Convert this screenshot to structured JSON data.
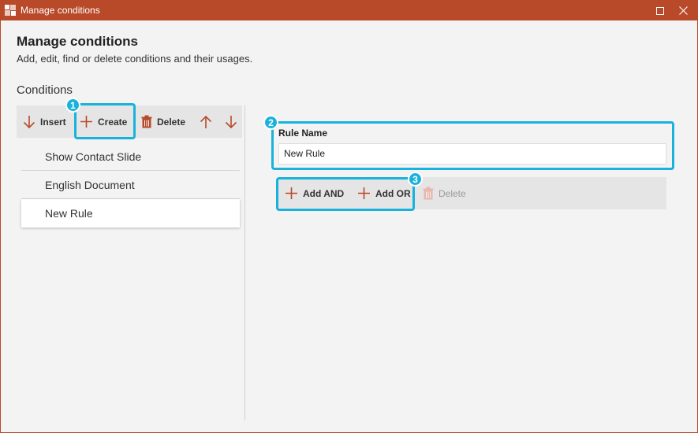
{
  "window": {
    "title": "Manage conditions",
    "accent": "#b84a2a"
  },
  "header": {
    "title": "Manage conditions",
    "subtitle": "Add, edit, find or delete conditions and their usages."
  },
  "conditions": {
    "section_label": "Conditions",
    "toolbar": {
      "insert_label": "Insert",
      "create_label": "Create",
      "delete_label": "Delete"
    },
    "items": [
      {
        "label": "Show Contact Slide",
        "selected": false
      },
      {
        "label": "English Document",
        "selected": false
      },
      {
        "label": "New Rule",
        "selected": true
      }
    ]
  },
  "rule": {
    "name_label": "Rule Name",
    "name_value": "New Rule",
    "toolbar": {
      "add_and_label": "Add AND",
      "add_or_label": "Add OR",
      "delete_label": "Delete"
    }
  },
  "callouts": [
    {
      "number": "1"
    },
    {
      "number": "2"
    },
    {
      "number": "3"
    }
  ],
  "colors": {
    "callout": "#19b2dc",
    "icon": "#b84a2a",
    "disabled": "#9a9a9a"
  }
}
